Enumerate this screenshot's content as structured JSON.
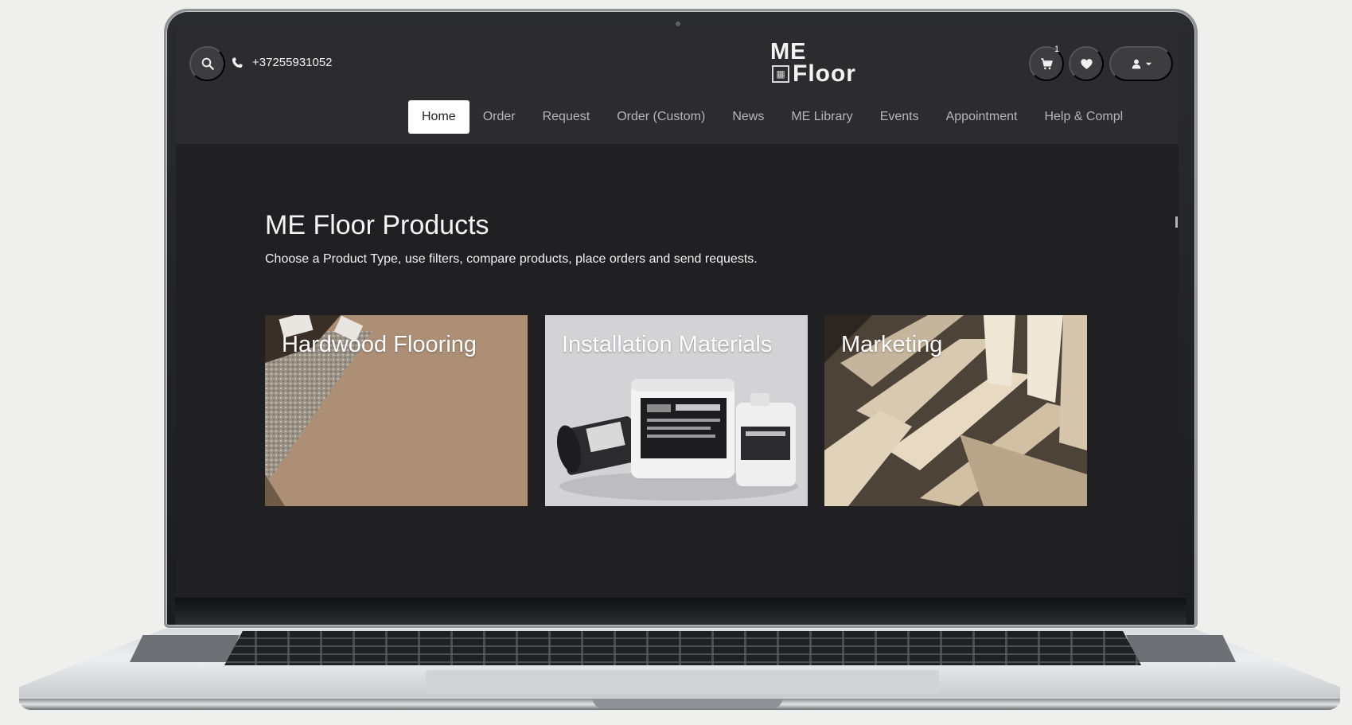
{
  "header": {
    "search_icon": "search-icon",
    "phone_icon": "phone-icon",
    "phone_number": "+37255931052",
    "logo_top": "ME",
    "logo_bottom": "Floor",
    "cart_icon": "cart-icon",
    "cart_count": "1",
    "wishlist_icon": "heart-icon",
    "user_icon": "user-icon"
  },
  "nav": {
    "items": [
      {
        "label": "Home",
        "active": true
      },
      {
        "label": "Order"
      },
      {
        "label": "Request"
      },
      {
        "label": "Order (Custom)"
      },
      {
        "label": "News"
      },
      {
        "label": "ME Library"
      },
      {
        "label": "Events"
      },
      {
        "label": "Appointment"
      },
      {
        "label": "Help & Compl"
      }
    ]
  },
  "main": {
    "title": "ME Floor Products",
    "description": "Choose a Product Type, use filters, compare products, place orders and send requests.",
    "cards": [
      {
        "label": "Hardwood Flooring"
      },
      {
        "label": "Installation Materials"
      },
      {
        "label": "Marketing"
      }
    ]
  },
  "colors": {
    "page_background": "#efefed",
    "screen_background": "#202022",
    "header_background": "#2c2c2e",
    "active_nav_background": "#ffffff",
    "nav_text": "#b7b7b7"
  }
}
